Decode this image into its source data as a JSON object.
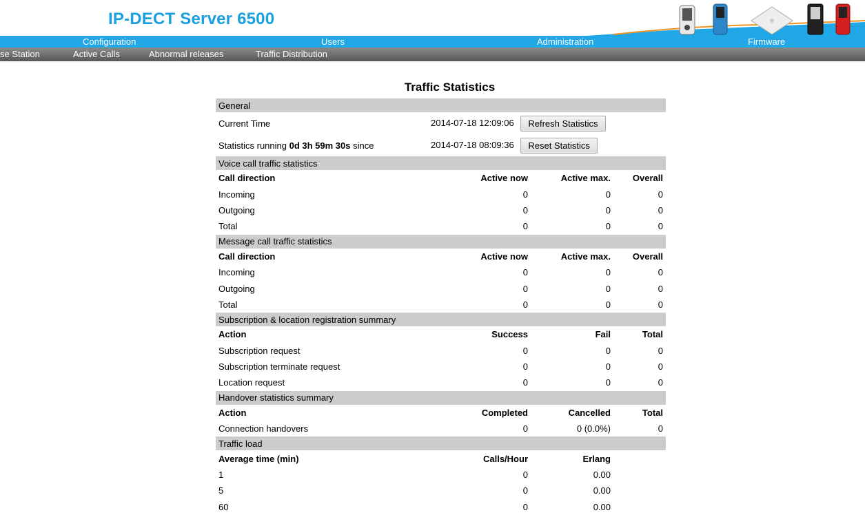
{
  "app": {
    "title": "IP-DECT Server 6500"
  },
  "mainnav": [
    "Configuration",
    "Users",
    "Administration",
    "Firmware"
  ],
  "subnav": [
    "se Station",
    "Active Calls",
    "Abnormal releases",
    "Traffic Distribution"
  ],
  "page_title": "Traffic Statistics",
  "general": {
    "heading": "General",
    "current_time_label": "Current Time",
    "current_time": "2014-07-18 12:09:06",
    "refresh_button": "Refresh Statistics",
    "running_prefix": "Statistics running ",
    "running_duration": "0d 3h 59m 30s",
    "running_suffix": " since",
    "since_time": "2014-07-18 08:09:36",
    "reset_button": "Reset Statistics"
  },
  "voice": {
    "heading": "Voice call traffic statistics",
    "columns": [
      "Call direction",
      "Active now",
      "Active max.",
      "Overall"
    ],
    "rows": [
      [
        "Incoming",
        "0",
        "0",
        "0"
      ],
      [
        "Outgoing",
        "0",
        "0",
        "0"
      ],
      [
        "Total",
        "0",
        "0",
        "0"
      ]
    ]
  },
  "message": {
    "heading": "Message call traffic statistics",
    "columns": [
      "Call direction",
      "Active now",
      "Active max.",
      "Overall"
    ],
    "rows": [
      [
        "Incoming",
        "0",
        "0",
        "0"
      ],
      [
        "Outgoing",
        "0",
        "0",
        "0"
      ],
      [
        "Total",
        "0",
        "0",
        "0"
      ]
    ]
  },
  "subscription": {
    "heading": "Subscription & location registration summary",
    "columns": [
      "Action",
      "Success",
      "Fail",
      "Total"
    ],
    "rows": [
      [
        "Subscription request",
        "0",
        "0",
        "0"
      ],
      [
        "Subscription terminate request",
        "0",
        "0",
        "0"
      ],
      [
        "Location request",
        "0",
        "0",
        "0"
      ]
    ]
  },
  "handover": {
    "heading": "Handover statistics summary",
    "columns": [
      "Action",
      "Completed",
      "Cancelled",
      "Total"
    ],
    "rows": [
      [
        "Connection handovers",
        "0",
        "0 (0.0%)",
        "0"
      ]
    ]
  },
  "traffic_load": {
    "heading": "Traffic load",
    "columns": [
      "Average time (min)",
      "Calls/Hour",
      "Erlang",
      ""
    ],
    "rows": [
      [
        "1",
        "0",
        "0.00",
        ""
      ],
      [
        "5",
        "0",
        "0.00",
        ""
      ],
      [
        "60",
        "0",
        "0.00",
        ""
      ]
    ]
  },
  "colors": {
    "accent": "#1aa0e0",
    "nav": "#21a6e6",
    "section": "#cccccc"
  }
}
